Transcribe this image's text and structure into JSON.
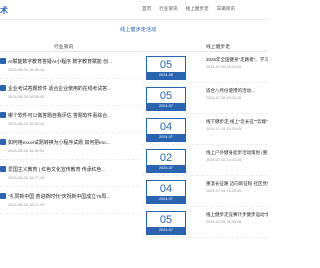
{
  "site": {
    "logo": "术"
  },
  "nav": [
    "首页",
    "行业资讯",
    "线上健步走",
    "车辆资讯"
  ],
  "banner": {
    "title": "线上健步走活动"
  },
  "left_column": {
    "header": "行业资讯",
    "items": [
      {
        "title": "AI赋能数字教育答疑AI小程序 数字教育赋能 创...",
        "date": "2024-08-05 16:36:43"
      },
      {
        "title": "企业考试答题软件 适合企业使用的在线考试答...",
        "date": "2024-08-05 16:36:43"
      },
      {
        "title": "哪个软件可以做答题自我评估 答题软件看综合...",
        "date": "2024-08-05 16:36:43"
      },
      {
        "title": "如何用excel试题转换为小程序试题 如何把exc...",
        "date": "2024-08-05 16:35:51"
      },
      {
        "title": "爱国主义教育 | 红色文化宣传教育 传承红色...",
        "date": "2024-08-05 16:27:43"
      },
      {
        "title": "\"礼赞新中国 奋进新时代\"庆祝新中国成立75周...",
        "date": "2024-08-05 16:27:43"
      }
    ]
  },
  "right_column": {
    "header": "线上健步走",
    "items": [
      {
        "day": "05",
        "ym": "2024-08",
        "title": "2025年全国健身\"走路者\"、学习\"\"...",
        "date": "2024-07-05 16:33:45"
      },
      {
        "day": "05",
        "ym": "2024-07",
        "title": "适合八月份使用的活动...",
        "date": "2024-07-05 16:33:45"
      },
      {
        "day": "04",
        "ym": "2024-07",
        "title": "线下健步走 线上\"云长征\"\"云端\"重走长征...",
        "date": "2024-07-04 16:33:45"
      },
      {
        "day": "02",
        "ym": "2024-07",
        "title": "线上户外健身徒步活动策划 (重走红军长征...",
        "date": "2024-07-02 16:33:45"
      },
      {
        "day": "04",
        "ym": "2024-07",
        "title": "重温长征路 迈向新征程 社区党委开展健步...",
        "date": "2024-07-04 16:33:45"
      },
      {
        "day": "05",
        "ym": "2024-07",
        "title": "线上健步走竞赛计步健步运动\"健康赢家...",
        "date": "2024-07-05 16:33:45"
      }
    ]
  }
}
